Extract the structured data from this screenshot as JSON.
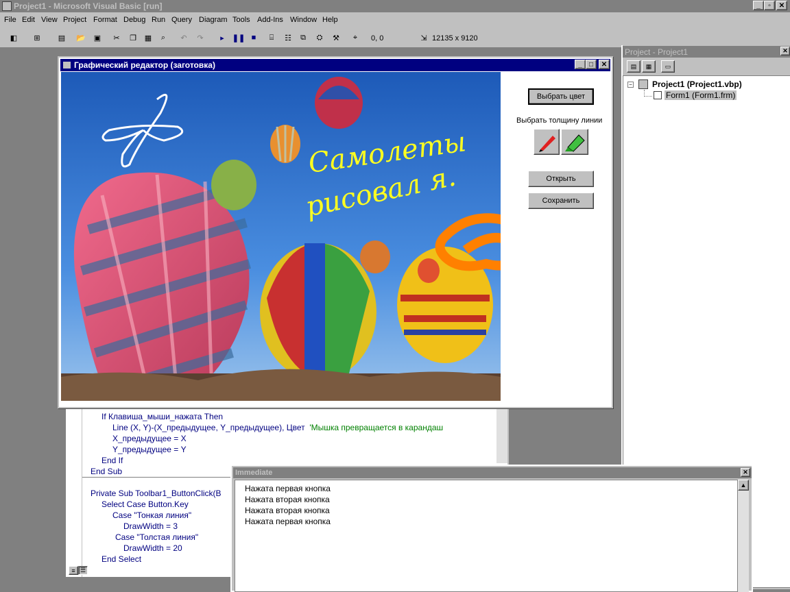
{
  "app": {
    "title": "Project1 - Microsoft Visual Basic [run]"
  },
  "menu": [
    "File",
    "Edit",
    "View",
    "Project",
    "Format",
    "Debug",
    "Run",
    "Query",
    "Diagram",
    "Tools",
    "Add-Ins",
    "Window",
    "Help"
  ],
  "toolbar": {
    "position": "0, 0",
    "size": "12135 x 9120"
  },
  "form": {
    "title": "Графический редактор (заготовка)",
    "buttons": {
      "choose_color": "Выбрать цвет",
      "line_width_label": "Выбрать толщину линии",
      "open": "Открыть",
      "save": "Сохранить"
    },
    "handwriting": {
      "line1": "Самолеты",
      "line2": "рисовал я."
    }
  },
  "project_explorer": {
    "title": "Project - Project1",
    "root": "Project1 (Project1.vbp)",
    "child": "Form1 (Form1.frm)"
  },
  "code": {
    "lines_top": [
      {
        "indent": 1,
        "text": "If Клавиша_мыши_нажата Then"
      },
      {
        "indent": 2,
        "text": "Line (X, Y)-(X_предыдущее, Y_предыдущее), Цвет  ",
        "comment": "'Мышка превращается в карандаш"
      },
      {
        "indent": 2,
        "text": "X_предыдущее = X"
      },
      {
        "indent": 2,
        "text": "Y_предыдущее = Y"
      },
      {
        "indent": 1,
        "text": "End If"
      },
      {
        "indent": 0,
        "text": "End Sub"
      }
    ],
    "lines_bottom": [
      {
        "indent": 0,
        "text": "Private Sub Toolbar1_ButtonClick(B"
      },
      {
        "indent": 1,
        "text": "Select Case Button.Key"
      },
      {
        "indent": 2,
        "text": "Case \"Тонкая линия\""
      },
      {
        "indent": 3,
        "text": "DrawWidth = 3"
      },
      {
        "indent": 2,
        "text": "Case \"Толстая линия\""
      },
      {
        "indent": 3,
        "text": "DrawWidth = 20"
      },
      {
        "indent": 1,
        "text": "End Select"
      }
    ]
  },
  "immediate": {
    "title": "Immediate",
    "lines": [
      "Нажата первая кнопка",
      "Нажата вторая кнопка",
      "Нажата вторая кнопка",
      "Нажата первая кнопка"
    ]
  },
  "colors": {
    "titlebar": "#000080",
    "inactive_titlebar": "#808080",
    "face": "#c0c0c0",
    "comment": "#008000"
  }
}
